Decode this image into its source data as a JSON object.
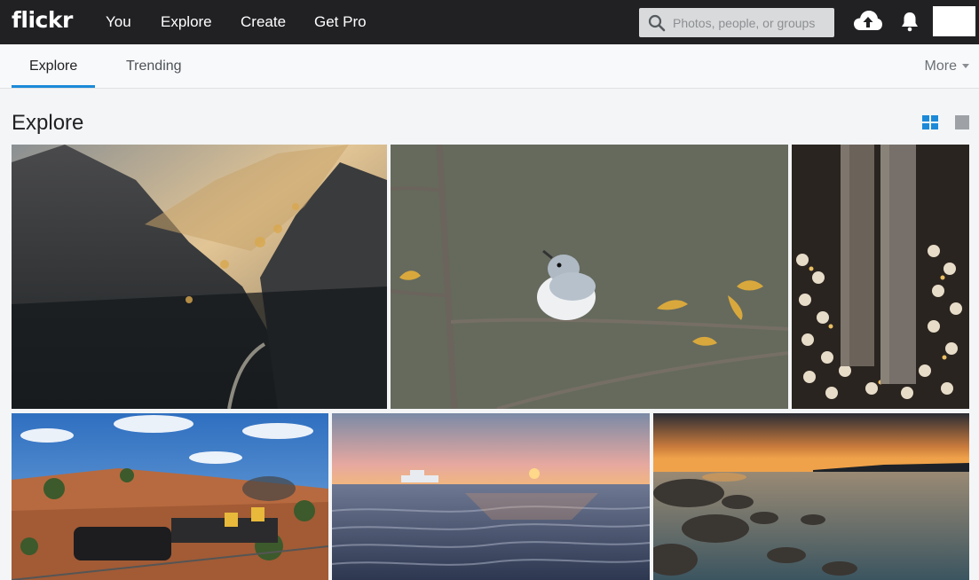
{
  "header": {
    "logo": "flickr",
    "nav": [
      "You",
      "Explore",
      "Create",
      "Get Pro"
    ],
    "search_placeholder": "Photos, people, or groups"
  },
  "subnav": {
    "tabs": [
      "Explore",
      "Trending"
    ],
    "active_tab": "Explore",
    "more_label": "More"
  },
  "page": {
    "title": "Explore"
  },
  "colors": {
    "topbar": "#212124",
    "accent": "#1c8ad8"
  },
  "photos": [
    {
      "subject": "misty forested mountain valley at sunrise"
    },
    {
      "subject": "blue-gray gnatcatcher perched on a budding branch"
    },
    {
      "subject": "crowd of people holding candles beside stone columns"
    },
    {
      "subject": "steam locomotive on a track through red hills"
    },
    {
      "subject": "rippled beach at sunset with a ship on the horizon"
    },
    {
      "subject": "rocky shoreline at dusk with sunset glow"
    }
  ]
}
